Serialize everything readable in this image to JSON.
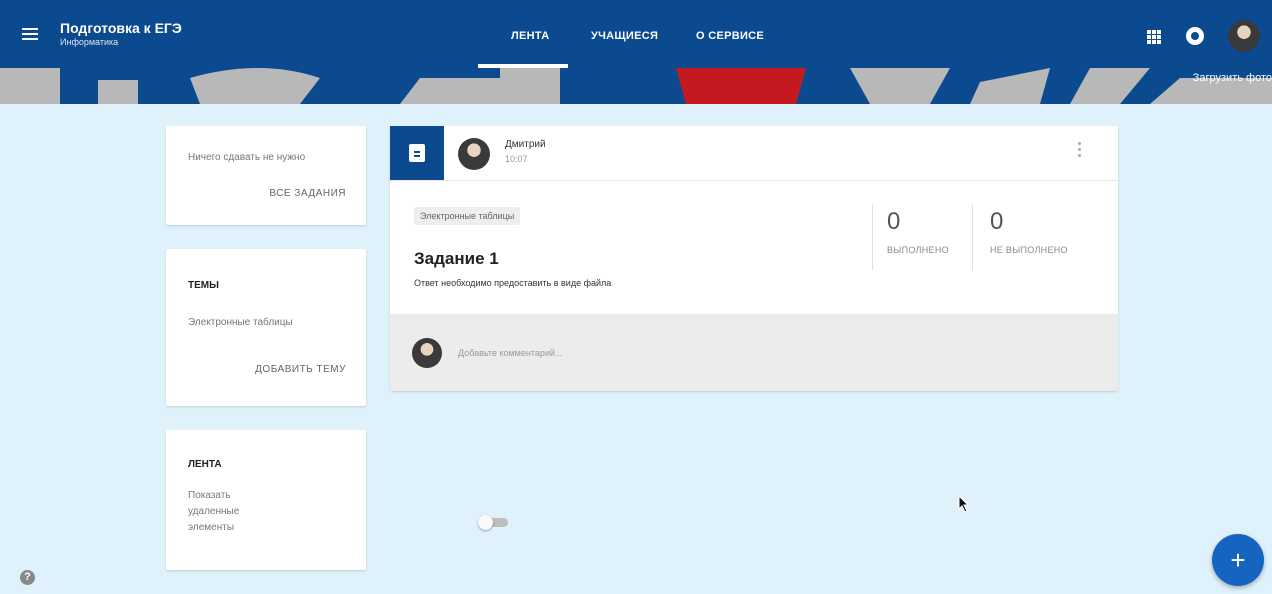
{
  "header": {
    "course_title": "Подготовка к ЕГЭ",
    "course_subtitle": "Информатика",
    "tabs": [
      {
        "label": "ЛЕНТА"
      },
      {
        "label": "УЧАЩИЕСЯ"
      },
      {
        "label": "О СЕРВИСЕ"
      }
    ]
  },
  "banner": {
    "upload_label": "Загрузить фото"
  },
  "upcoming": {
    "text": "Ничего сдавать не нужно",
    "action": "ВСЕ ЗАДАНИЯ"
  },
  "topics": {
    "heading": "ТЕМЫ",
    "item": "Электронные таблицы",
    "action": "ДОБАВИТЬ ТЕМУ"
  },
  "stream": {
    "heading": "ЛЕНТА",
    "toggle_label": "Показать удаленные элементы",
    "toggle_on": false
  },
  "post": {
    "author": "Дмитрий",
    "time": "10:07",
    "topic_tag": "Электронные таблицы",
    "title": "Задание 1",
    "description": "Ответ необходимо предоставить в виде файла",
    "done_count": "0",
    "done_label": "ВЫПОЛНЕНО",
    "not_done_count": "0",
    "not_done_label": "НЕ ВЫПОЛНЕНО",
    "comment_placeholder": "Добавьте комментарий..."
  },
  "fab": {
    "label": "+"
  },
  "help": {
    "label": "?"
  },
  "colors": {
    "primary": "#0b4a8f",
    "background": "#dff1fb",
    "banner_red": "#c41a1f",
    "banner_grey": "#b8b8b8"
  }
}
